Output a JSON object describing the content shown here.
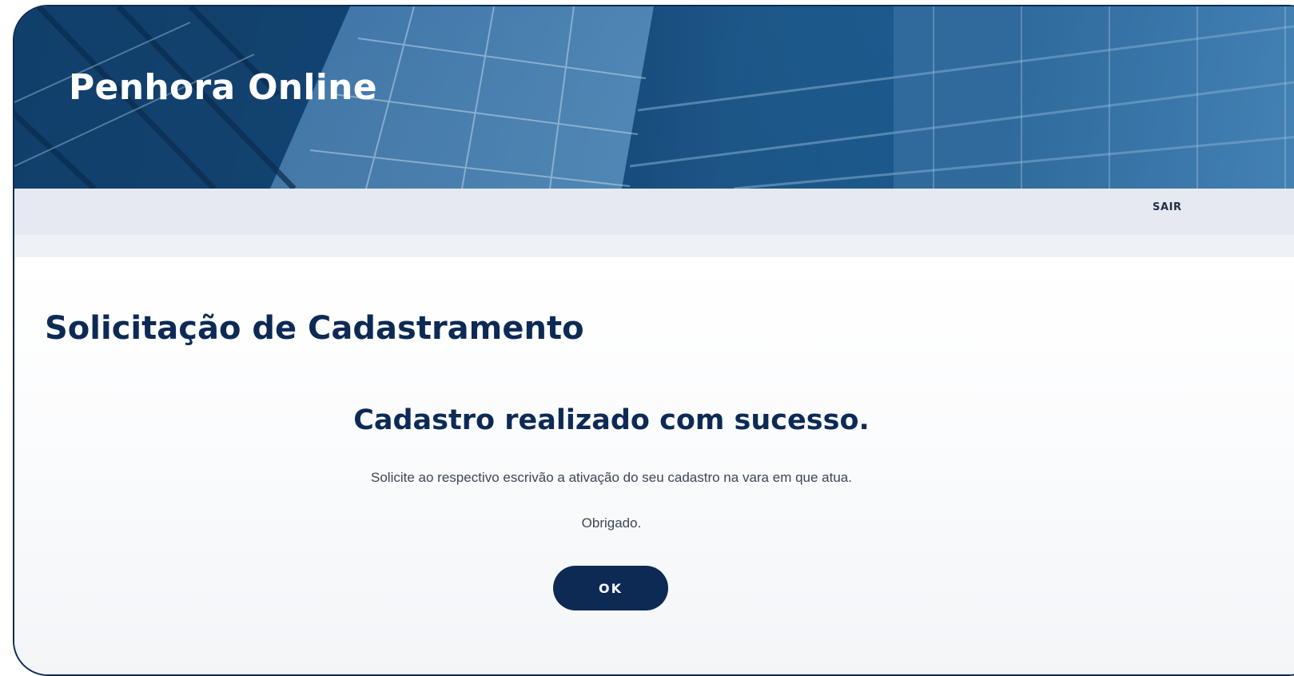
{
  "header": {
    "app_title": "Penhora Online",
    "logout_label": "SAIR"
  },
  "main": {
    "page_title": "Solicitação de Cadastramento",
    "success_title": "Cadastro realizado com sucesso.",
    "message": "Solicite ao respectivo escrivão a ativação do seu cadastro na vara em que atua.",
    "thanks": "Obrigado.",
    "ok_label": "OK"
  },
  "colors": {
    "primary": "#0d2a55",
    "topbar": "#e6eaf0",
    "hero": "#1d5c92"
  }
}
